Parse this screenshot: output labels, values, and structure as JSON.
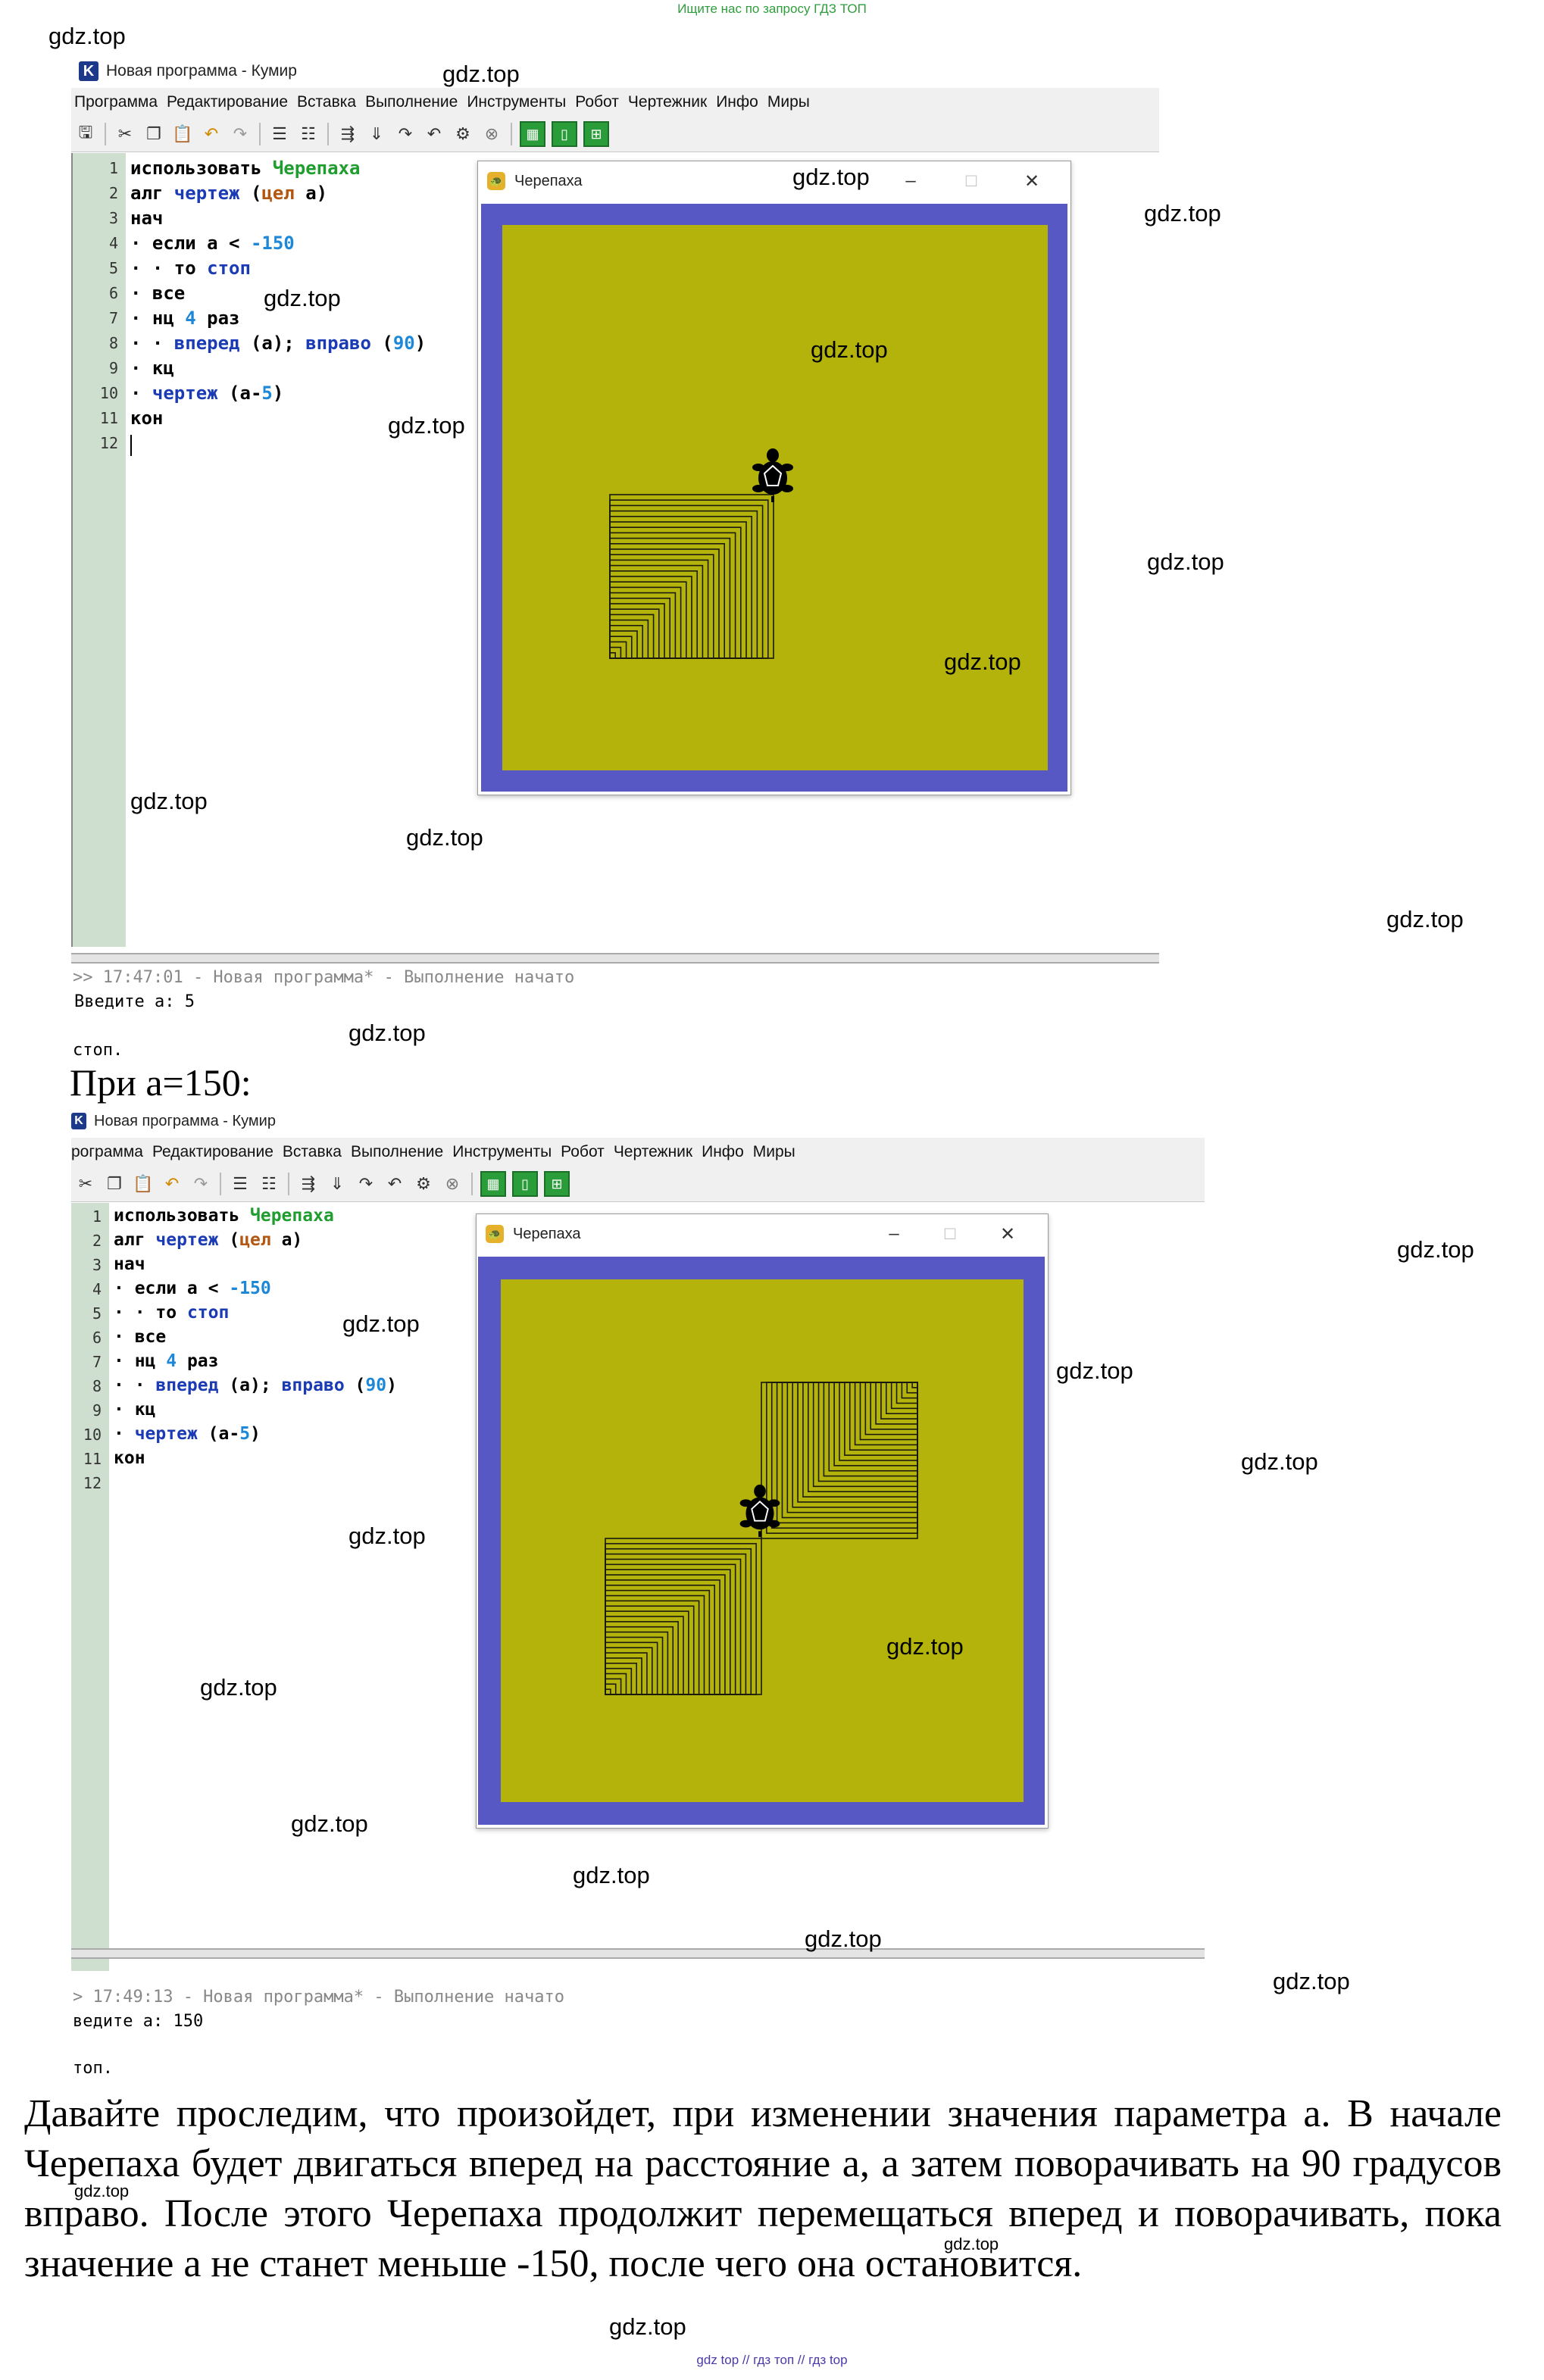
{
  "top_link": "Ищите нас по запросу ГДЗ ТОП",
  "bottom_link": "gdz top  //  гдз топ  //  гдз top",
  "watermark": "gdz.top",
  "ide": {
    "title": "Новая программа - Кумир",
    "logo": "K",
    "menu": [
      "Программа",
      "Редактирование",
      "Вставка",
      "Выполнение",
      "Инструменты",
      "Робот",
      "Чертежник",
      "Инфо",
      "Миры"
    ],
    "menu2_first": "рограмма",
    "icons": [
      "save-icon",
      "cut-icon",
      "copy-icon",
      "paste-icon",
      "undo-icon",
      "redo-icon",
      "indent-icon",
      "unindent-icon",
      "run-icon",
      "step-icon",
      "step-in-icon",
      "step-out-icon",
      "debug-icon",
      "stop-icon",
      "grid-icon",
      "frame-icon",
      "grid4-icon"
    ]
  },
  "code": {
    "line_numbers": [
      "1",
      "2",
      "3",
      "4",
      "5",
      "6",
      "7",
      "8",
      "9",
      "10",
      "11",
      "12"
    ],
    "l1a": "использовать ",
    "l1b": "Черепаха",
    "l2a": "алг ",
    "l2b": "чертеж",
    "l2c": " (",
    "l2d": "цел",
    "l2e": " a)",
    "l3": "нач",
    "l4a": "· если a < ",
    "l4b": "-150",
    "l5a": "· · то ",
    "l5b": "стоп",
    "l6": "· все",
    "l7a": "· нц ",
    "l7b": "4",
    "l7c": " раз",
    "l8a": "· · ",
    "l8b": "вперед",
    "l8c": " (a); ",
    "l8d": "вправо",
    "l8e": " (",
    "l8f": "90",
    "l8g": ")",
    "l9": "· кц",
    "l10a": "· ",
    "l10b": "чертеж",
    "l10c": " (a-",
    "l10d": "5",
    "l10e": ")",
    "l11": "кон"
  },
  "turtle_window": {
    "title": "Черепаха",
    "min": "–",
    "max": "□",
    "close": "✕"
  },
  "run1": {
    "console_line1": ">> 17:47:01 - Новая программа* - Выполнение начато",
    "console_line2": "Введите a: 5",
    "console_line3": "стоп."
  },
  "heading": "При а=150:",
  "run2": {
    "console_line1": "> 17:49:13 - Новая программа* - Выполнение начато",
    "console_line2": "ведите a: 150",
    "console_line3": "топ."
  },
  "paragraph": "Давайте проследим, что произойдет, при изменении значения параметра а. В начале Черепаха будет двигаться вперед на расстояние а, а затем поворачивать на 90 градусов вправо. После этого Черепаха продолжит перемещаться вперед и поворачивать, пока значение а не станет меньше -150, после чего она остановится."
}
